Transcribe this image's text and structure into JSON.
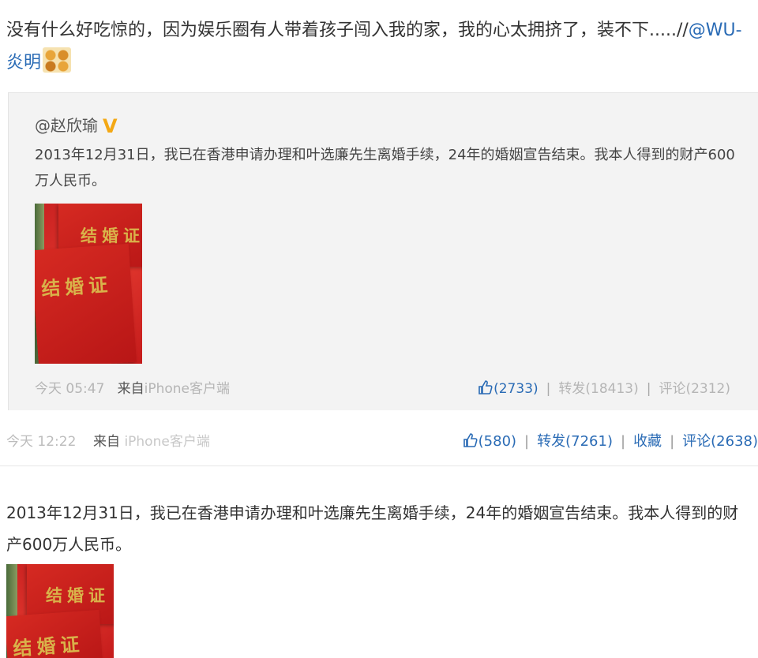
{
  "post": {
    "text": "没有什么好吃惊的，因为娱乐圈有人带着孩子闯入我的家，我的心太拥挤了，装不下.....//",
    "mention": "@WU-炎明"
  },
  "quote": {
    "author": "@赵欣瑜",
    "verified_badge": "V",
    "text": "2013年12月31日，我已在香港申请办理和叶选廉先生离婚手续，24年的婚姻宣告结束。我本人得到的财产600万人民币。",
    "image_text_front": "结婚证",
    "image_text_back": "结婚证",
    "time": "今天 05:47",
    "source_label": "来自",
    "source_link": "iPhone客户端",
    "like_count": "(2733)",
    "repost": "转发(18413)",
    "comment": "评论(2312)"
  },
  "meta": {
    "time": "今天 12:22",
    "source_label": "来自",
    "source_link": "iPhone客户端",
    "like_count": "(580)",
    "repost": "转发(7261)",
    "favorite": "收藏",
    "comment": "评论(2638)"
  },
  "post2": {
    "text": "2013年12月31日，我已在香港申请办理和叶选廉先生离婚手续，24年的婚姻宣告结束。我本人得到的财产600万人民币。",
    "image_text_front": "结婚证",
    "image_text_back": "结婚证"
  },
  "colors": {
    "link": "#2a6bb5",
    "verified": "#f3a815",
    "certificate_red": "#d62a22"
  },
  "icons": [
    "thumbs-up-icon",
    "verified-icon",
    "emoji-icon"
  ]
}
